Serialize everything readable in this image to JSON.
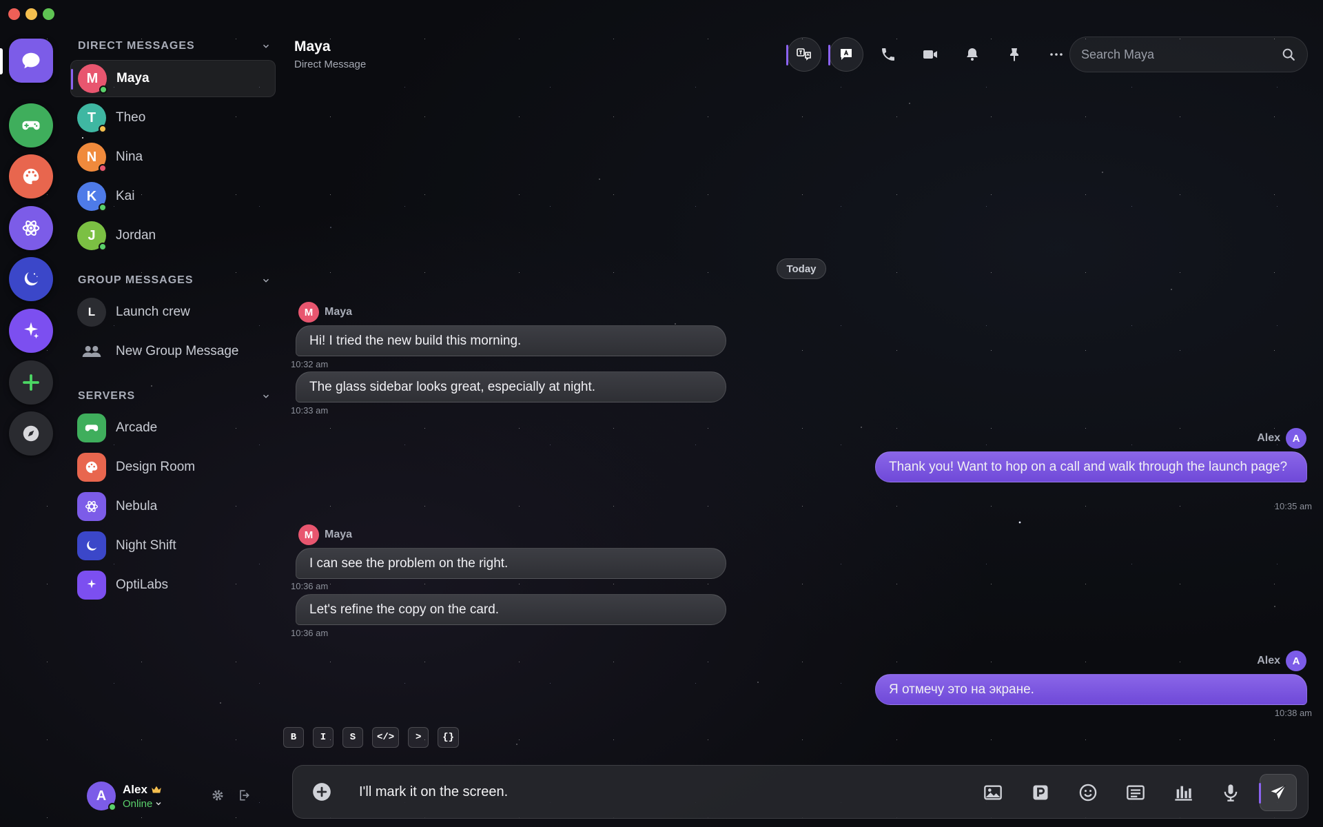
{
  "sidebar": {
    "direct_messages_header": "DIRECT MESSAGES",
    "group_messages_header": "GROUP MESSAGES",
    "servers_header": "SERVERS",
    "direct_messages": [
      {
        "initial": "M",
        "name": "Maya",
        "color": "#e8566f",
        "status": "#5ad16b"
      },
      {
        "initial": "T",
        "name": "Theo",
        "color": "#3fb7a2",
        "status": "#f4bf4f"
      },
      {
        "initial": "N",
        "name": "Nina",
        "color": "#f08a3c",
        "status": "#e8566f"
      },
      {
        "initial": "K",
        "name": "Kai",
        "color": "#4e7be8",
        "status": "#5ad16b"
      },
      {
        "initial": "J",
        "name": "Jordan",
        "color": "#7bc043",
        "status": "#5ad16b"
      }
    ],
    "groups": [
      {
        "initial": "L",
        "name": "Launch crew"
      },
      {
        "name": "New Group Message"
      }
    ],
    "servers": [
      {
        "name": "Arcade",
        "icon": "gamepad-icon",
        "color": "#3fae5c"
      },
      {
        "name": "Design Room",
        "icon": "palette-icon",
        "color": "#e8664e"
      },
      {
        "name": "Nebula",
        "icon": "atom-icon",
        "color": "#7c5ce8"
      },
      {
        "name": "Night Shift",
        "icon": "moon-icon",
        "color": "#3b47c9"
      },
      {
        "name": "OptiLabs",
        "icon": "sparkle-icon",
        "color": "#7c4ff0"
      }
    ]
  },
  "user": {
    "initial": "A",
    "name": "Alex",
    "status": "Online"
  },
  "chat": {
    "title": "Maya",
    "subtitle": "Direct Message",
    "search_placeholder": "Search Maya",
    "date_divider": "Today",
    "composer_value": "I'll mark it on the screen.",
    "messages": [
      {
        "sender": "Maya",
        "initial": "M",
        "text": "Hi! I tried the new build this morning.",
        "time": "10:32 am"
      },
      {
        "text": "The glass sidebar looks great, especially at night.",
        "time": "10:33 am"
      },
      {
        "sender": "Alex",
        "initial": "A",
        "text": "Thank you! Want to hop on a call and walk through the launch page?",
        "time": "10:35 am"
      },
      {
        "sender": "Maya",
        "initial": "M",
        "text": "I can see the problem on the right.",
        "time": "10:36 am"
      },
      {
        "text": "Let's refine the copy on the card.",
        "time": "10:36 am"
      },
      {
        "sender": "Alex",
        "initial": "A",
        "text": "Я отмечу это на экране.",
        "time": "10:38 am"
      }
    ]
  },
  "format_toolbar": [
    "B",
    "I",
    "S",
    "</>",
    ">",
    "{}"
  ],
  "colors": {
    "accent": "#8b63f0",
    "online": "#5ad16b"
  }
}
